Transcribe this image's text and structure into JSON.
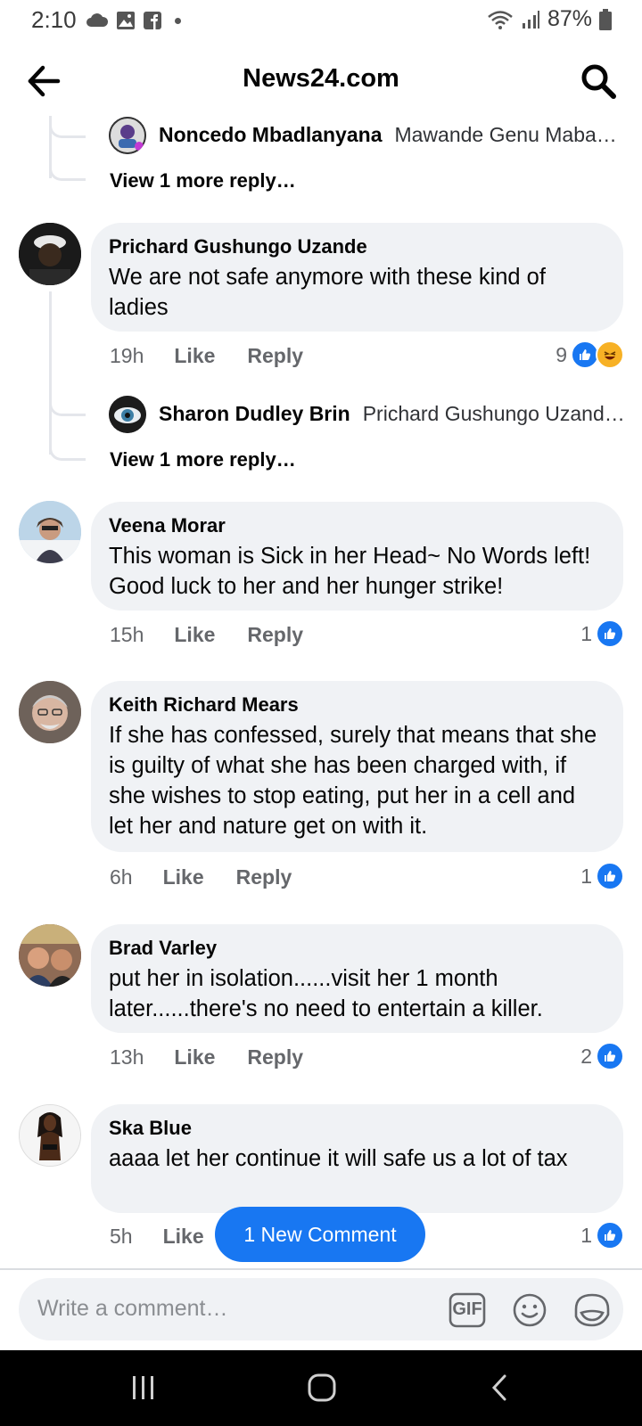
{
  "status_bar": {
    "time": "2:10",
    "battery": "87%"
  },
  "header": {
    "title": "News24.com"
  },
  "top_reply": {
    "name": "Noncedo Mbadlanyana",
    "text": "Mawande Genu Maba…",
    "more": "View 1 more reply…"
  },
  "comments": [
    {
      "author": "Prichard Gushungo Uzande",
      "text": "We are not safe anymore with these kind of ladies",
      "time": "19h",
      "like": "Like",
      "reply": "Reply",
      "reactions": "9",
      "reply_preview": {
        "name": "Sharon Dudley Brin",
        "text": "Prichard Gushungo Uzande…",
        "more": "View 1 more reply…"
      }
    },
    {
      "author": "Veena Morar",
      "text": "This woman is Sick in her Head~ No Words left! Good luck to her and her hunger strike!",
      "time": "15h",
      "like": "Like",
      "reply": "Reply",
      "reactions": "1"
    },
    {
      "author": "Keith Richard Mears",
      "text": "If she has confessed, surely that means that she is guilty of what she has been charged with, if she wishes to stop eating, put her in a cell and let her and nature get on with it.",
      "time": "6h",
      "like": "Like",
      "reply": "Reply",
      "reactions": "1"
    },
    {
      "author": "Brad Varley",
      "text": "put her in isolation......visit her 1 month later......there's no need to entertain a killer.",
      "time": "13h",
      "like": "Like",
      "reply": "Reply",
      "reactions": "2"
    },
    {
      "author": "Ska Blue",
      "text": "aaaa let her continue it will safe us a lot of tax",
      "time": "5h",
      "like": "Like",
      "reactions": "1"
    }
  ],
  "new_comment_pill": "1 New Comment",
  "composer": {
    "placeholder": "Write a comment…",
    "gif_label": "GIF"
  },
  "icons": {
    "like_color": "#1877f2",
    "bubble_color": "#f0f2f5"
  }
}
